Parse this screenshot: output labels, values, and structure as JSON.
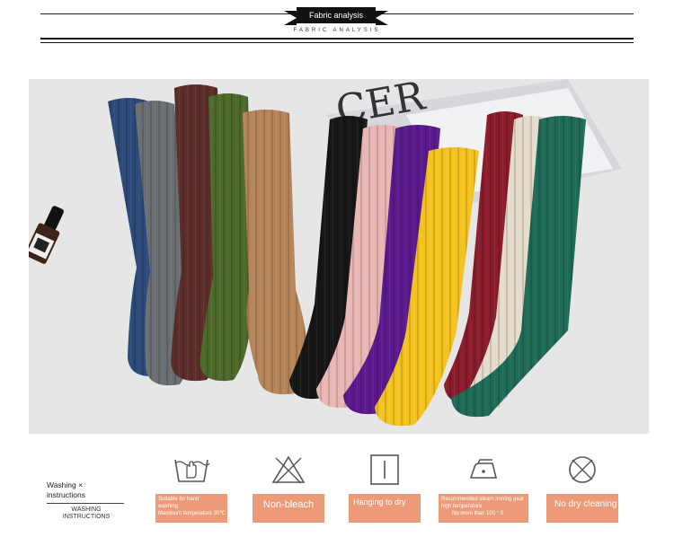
{
  "header": {
    "banner_label": "Fabric analysis",
    "subtitle": "FABRIC ANALYSIS"
  },
  "photo": {
    "background_color": "#e6e6e6",
    "sock_colors": [
      "#2c4a7a",
      "#6b6e72",
      "#5c2e2a",
      "#4d6a2a",
      "#b58559",
      "#161616",
      "#e8b6b3",
      "#5a1a8e",
      "#f3c21e",
      "#8a1c2c",
      "#e5dccb",
      "#1f6b57"
    ],
    "card_text": "CER"
  },
  "care": {
    "title_line1": "Washing ×",
    "title_line2": "instructions",
    "title_line3": "WASHING",
    "title_line4": "INSTRUCTIONS",
    "items": [
      {
        "icon": "hand-wash-icon",
        "label_line1": "Suitable for hand",
        "label_line2": "washing",
        "label_line3": "Maximum temperature 30℃"
      },
      {
        "icon": "no-bleach-icon",
        "label": "Non-bleach"
      },
      {
        "icon": "hang-dry-icon",
        "label": "Hanging to dry"
      },
      {
        "icon": "iron-icon",
        "label_line1": "Recommended steam ironing gear",
        "label_line2": "high temperature",
        "label_line3": "No more than 100 ° 0"
      },
      {
        "icon": "no-dry-clean-icon",
        "label": "No dry cleaning"
      }
    ],
    "accent_color": "#ec9a78"
  }
}
